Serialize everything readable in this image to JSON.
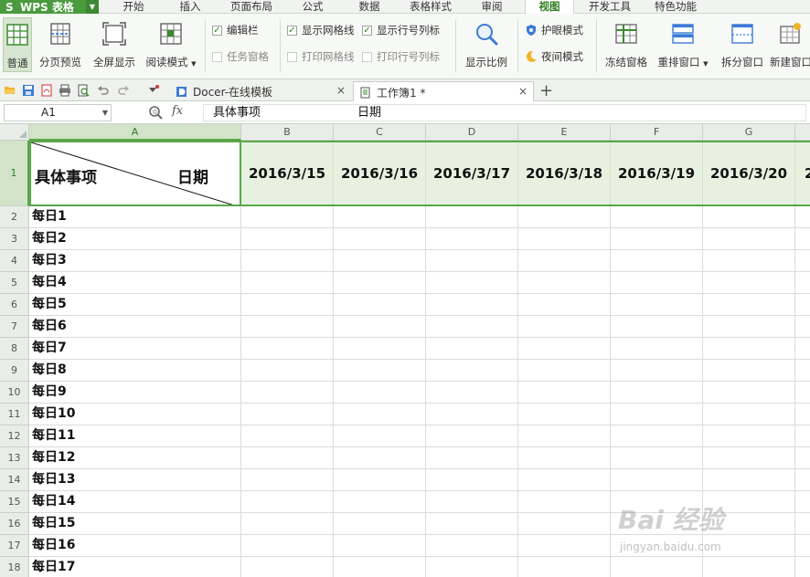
{
  "app": {
    "name": "WPS 表格",
    "accent": "#4a9a3e"
  },
  "menu": {
    "tabs": [
      {
        "label": "开始",
        "active": false
      },
      {
        "label": "插入",
        "active": false
      },
      {
        "label": "页面布局",
        "active": false
      },
      {
        "label": "公式",
        "active": false
      },
      {
        "label": "数据",
        "active": false
      },
      {
        "label": "表格样式",
        "active": false
      },
      {
        "label": "审阅",
        "active": false
      },
      {
        "label": "视图",
        "active": true
      },
      {
        "label": "开发工具",
        "active": false
      },
      {
        "label": "特色功能",
        "active": false
      }
    ]
  },
  "ribbon": {
    "normal": "普通",
    "page_preview": "分页预览",
    "fullscreen": "全屏显示",
    "reading_mode": "阅读模式",
    "edit_bar": "编辑栏",
    "task_pane": "任务窗格",
    "show_gridlines": "显示网格线",
    "print_gridlines": "打印网格线",
    "show_headers": "显示行号列标",
    "print_headers": "打印行号列标",
    "zoom": "显示比例",
    "eye_mode": "护眼模式",
    "night_mode": "夜间模式",
    "freeze": "冻结窗格",
    "rearrange": "重排窗口",
    "split": "拆分窗口",
    "new_window": "新建窗口"
  },
  "tabs": {
    "docer": "Docer-在线模板",
    "workbook": "工作簿1 *",
    "close_glyph": "×",
    "new_glyph": "+"
  },
  "formula_bar": {
    "name_box": "A1",
    "fx": "fx",
    "content_left": "具体事项",
    "content_right": "日期"
  },
  "grid": {
    "columns": [
      "A",
      "B",
      "C",
      "D",
      "E",
      "F",
      "G"
    ],
    "rows": [
      "1",
      "2",
      "3",
      "4",
      "5",
      "6",
      "7",
      "8",
      "9",
      "10",
      "11",
      "12",
      "13",
      "14",
      "15",
      "16",
      "17",
      "18"
    ],
    "a1_left": "具体事项",
    "a1_right": "日期",
    "dates": [
      "2016/3/15",
      "2016/3/16",
      "2016/3/17",
      "2016/3/18",
      "2016/3/19",
      "2016/3/20",
      "2"
    ],
    "items": [
      "每日1",
      "每日2",
      "每日3",
      "每日4",
      "每日5",
      "每日6",
      "每日7",
      "每日8",
      "每日9",
      "每日10",
      "每日11",
      "每日12",
      "每日13",
      "每日14",
      "每日15",
      "每日16",
      "每日17"
    ]
  },
  "watermark": {
    "brand": "Bai 经验",
    "url": "jingyan.baidu.com"
  }
}
